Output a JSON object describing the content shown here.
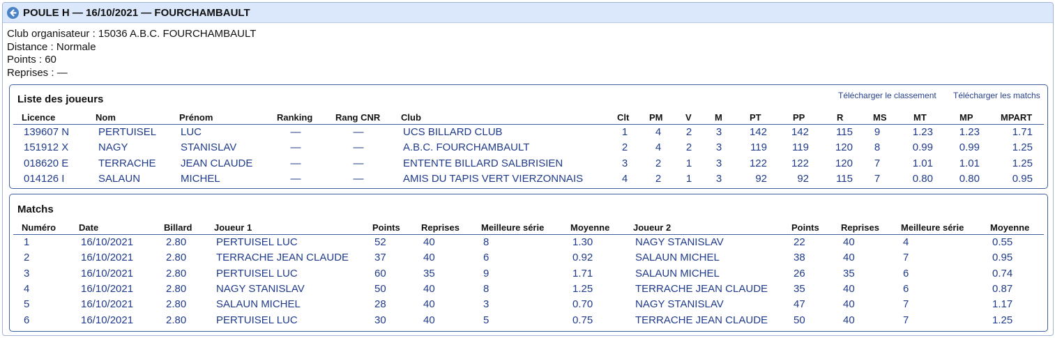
{
  "header": {
    "title": "POULE H — 16/10/2021 — FOURCHAMBAULT"
  },
  "info": {
    "club": "Club organisateur : 15036 A.B.C. FOURCHAMBAULT",
    "distance": "Distance : Normale",
    "points": "Points : 60",
    "reprises": "Reprises : —"
  },
  "players": {
    "title": "Liste des joueurs",
    "download_ranking": "Télécharger le classement",
    "download_matches": "Télécharger les matchs",
    "columns": [
      "Licence",
      "Nom",
      "Prénom",
      "Ranking",
      "Rang CNR",
      "Club",
      "Clt",
      "PM",
      "V",
      "M",
      "PT",
      "PP",
      "R",
      "MS",
      "MT",
      "MP",
      "MPART"
    ],
    "rows": [
      [
        "139607 N",
        "PERTUISEL",
        "LUC",
        "—",
        "—",
        "UCS BILLARD CLUB",
        "1",
        "4",
        "2",
        "3",
        "142",
        "142",
        "115",
        "9",
        "1.23",
        "1.23",
        "1.71"
      ],
      [
        "151912 X",
        "NAGY",
        "STANISLAV",
        "—",
        "—",
        "A.B.C. FOURCHAMBAULT",
        "2",
        "4",
        "2",
        "3",
        "119",
        "119",
        "120",
        "8",
        "0.99",
        "0.99",
        "1.25"
      ],
      [
        "018620 E",
        "TERRACHE",
        "JEAN CLAUDE",
        "—",
        "—",
        "ENTENTE BILLARD SALBRISIEN",
        "3",
        "2",
        "1",
        "3",
        "122",
        "122",
        "120",
        "7",
        "1.01",
        "1.01",
        "1.25"
      ],
      [
        "014126 I",
        "SALAUN",
        "MICHEL",
        "—",
        "—",
        "AMIS DU TAPIS VERT VIERZONNAIS",
        "4",
        "2",
        "1",
        "3",
        "92",
        "92",
        "115",
        "7",
        "0.80",
        "0.80",
        "0.95"
      ]
    ]
  },
  "matches": {
    "title": "Matchs",
    "columns": [
      "Numéro",
      "Date",
      "Billard",
      "Joueur 1",
      "Points",
      "Reprises",
      "Meilleure série",
      "Moyenne",
      "Joueur 2",
      "Points",
      "Reprises",
      "Meilleure série",
      "Moyenne"
    ],
    "rows": [
      [
        "1",
        "16/10/2021",
        "2.80",
        "PERTUISEL LUC",
        "52",
        "40",
        "8",
        "1.30",
        "NAGY STANISLAV",
        "22",
        "40",
        "4",
        "0.55"
      ],
      [
        "2",
        "16/10/2021",
        "2.80",
        "TERRACHE JEAN CLAUDE",
        "37",
        "40",
        "6",
        "0.92",
        "SALAUN MICHEL",
        "38",
        "40",
        "7",
        "0.95"
      ],
      [
        "3",
        "16/10/2021",
        "2.80",
        "PERTUISEL LUC",
        "60",
        "35",
        "9",
        "1.71",
        "SALAUN MICHEL",
        "26",
        "35",
        "6",
        "0.74"
      ],
      [
        "4",
        "16/10/2021",
        "2.80",
        "NAGY STANISLAV",
        "50",
        "40",
        "8",
        "1.25",
        "TERRACHE JEAN CLAUDE",
        "35",
        "40",
        "6",
        "0.87"
      ],
      [
        "5",
        "16/10/2021",
        "2.80",
        "SALAUN MICHEL",
        "28",
        "40",
        "3",
        "0.70",
        "NAGY STANISLAV",
        "47",
        "40",
        "7",
        "1.17"
      ],
      [
        "6",
        "16/10/2021",
        "2.80",
        "PERTUISEL LUC",
        "30",
        "40",
        "5",
        "0.75",
        "TERRACHE JEAN CLAUDE",
        "50",
        "40",
        "7",
        "1.25"
      ]
    ]
  }
}
